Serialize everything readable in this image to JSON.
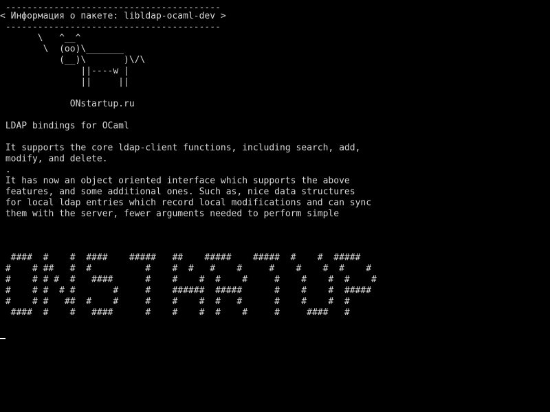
{
  "terminal": {
    "lines": [
      " ----------------------------------------",
      "< Информация о пакете: libldap-ocaml-dev >",
      " ----------------------------------------",
      "       \\   ^__^",
      "        \\  (oo)\\_______",
      "           (__)\\       )\\/\\",
      "               ||----w |",
      "               ||     ||",
      "",
      "             ONstartup.ru",
      "",
      " LDAP bindings for OCaml",
      "",
      " It supports the core ldap-client functions, including search, add,",
      " modify, and delete.",
      " .",
      " It has now an object oriented interface which supports the above",
      " features, and some additional ones. Such as, nice data structures",
      " for local ldap entries which record local modifications and can sync",
      " them with the server, fewer arguments needed to perform simple",
      "",
      "",
      "",
      "  ####  #    #  ####    #####   ##    #####    #####  #    #  #####",
      " #    # ##   #  #          #    #  #   #    #     #    #    #  #    #",
      " #    # # #  #   ####      #    #    #  #    #     #    #    #  #    #",
      " #    # #  # #       #     #    ######  #####      #    #    #  #####",
      " #    # #   ##  #    #     #    #    #  #   #      #    #    #  #",
      "  ####  #    #   ####      #    #    #  #    #     #     ####   #"
    ]
  }
}
